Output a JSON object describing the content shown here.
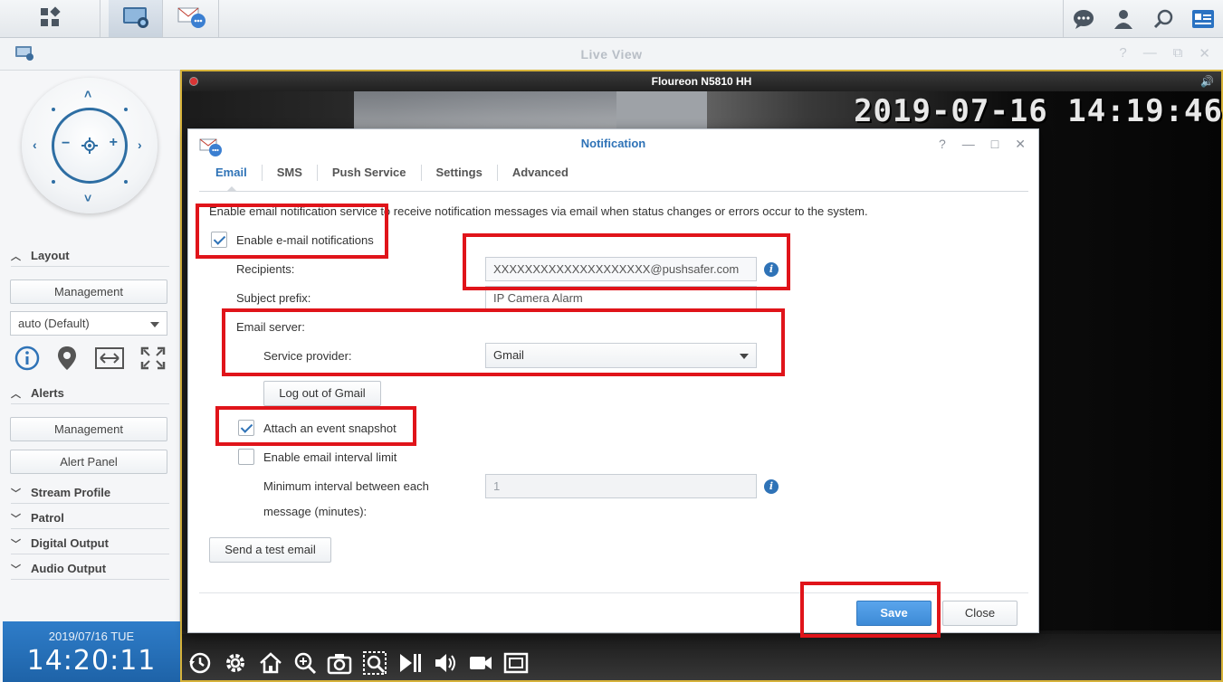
{
  "taskbar": {
    "apps": [
      {
        "name": "main-menu",
        "icon": "grid-icon"
      },
      {
        "name": "surveillance-live-view",
        "icon": "camera-monitor-icon"
      },
      {
        "name": "notification-app",
        "icon": "notification-icon"
      }
    ],
    "right_icons": [
      "chat-icon",
      "user-icon",
      "search-icon",
      "info-card-icon"
    ]
  },
  "live_view": {
    "title": "Live View",
    "controls": [
      "?",
      "—",
      "⧉",
      "✕"
    ]
  },
  "left_panel": {
    "sections": {
      "layout": "Layout",
      "alerts": "Alerts",
      "stream_profile": "Stream Profile",
      "patrol": "Patrol",
      "digital_output": "Digital Output",
      "audio_output": "Audio Output"
    },
    "layout_management": "Management",
    "layout_select": "auto (Default)",
    "alerts_management": "Management",
    "alert_panel": "Alert Panel",
    "clock_date": "2019/07/16  TUE",
    "clock_time": "14:20:11"
  },
  "camera": {
    "title": "Floureon N5810 HH",
    "osd": "2019-07-16  14:19:46"
  },
  "dialog": {
    "title": "Notification",
    "controls": [
      "?",
      "—",
      "□",
      "✕"
    ],
    "tabs": [
      "Email",
      "SMS",
      "Push Service",
      "Settings",
      "Advanced"
    ],
    "active_tab": "Email",
    "description": "Enable email notification service to receive notification messages via email when status changes or errors occur to the system.",
    "enable_email_label": "Enable e-mail notifications",
    "enable_email_checked": true,
    "recipients_label": "Recipients:",
    "recipients_value": "XXXXXXXXXXXXXXXXXXXX@pushsafer.com",
    "subject_prefix_label": "Subject prefix:",
    "subject_prefix_value": "IP Camera Alarm",
    "email_server_label": "Email server:",
    "service_provider_label": "Service provider:",
    "service_provider_value": "Gmail",
    "logout_button": "Log out of Gmail",
    "attach_snapshot_label": "Attach an event snapshot",
    "attach_snapshot_checked": true,
    "interval_limit_label": "Enable email interval limit",
    "interval_limit_checked": false,
    "min_interval_label_1": "Minimum interval between each",
    "min_interval_label_2": "message (minutes):",
    "min_interval_value": "1",
    "test_email_button": "Send a test email",
    "save_button": "Save",
    "close_button": "Close"
  },
  "colors": {
    "accent": "#2f73b7",
    "highlight": "#e0141a",
    "primary_button": "#4a98e2",
    "clock_bg": "#2672bd"
  }
}
